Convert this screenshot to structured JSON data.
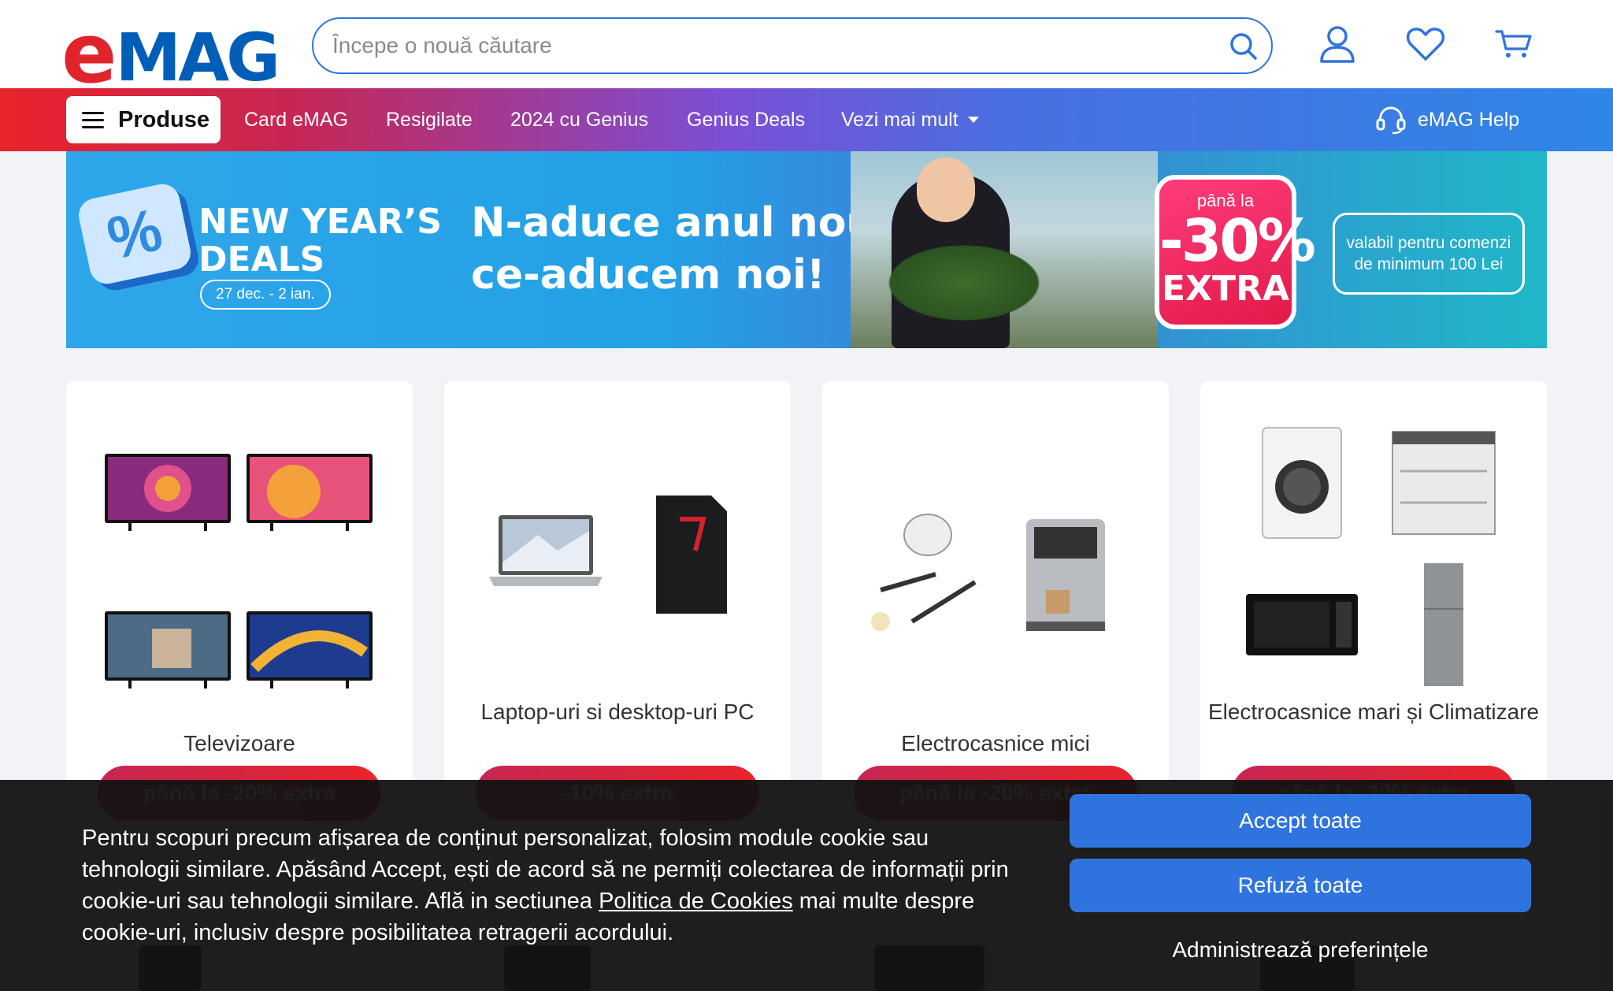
{
  "header": {
    "logo_text_e": "e",
    "logo_text_rest": "MAG",
    "search_placeholder": "Începe o nouă căutare",
    "search_icon": "search-icon",
    "account_icon": "user-icon",
    "favorites_icon": "heart-icon",
    "cart_icon": "cart-icon"
  },
  "nav": {
    "products_label": "Produse",
    "links": [
      "Card eMAG",
      "Resigilate",
      "2024 cu Genius",
      "Genius Deals",
      "Vezi mai mult"
    ],
    "help_label": "eMAG Help"
  },
  "banner": {
    "deals_title_line1": "NEW YEAR’S",
    "deals_title_line2": "DEALS",
    "dates": "27 dec. - 2 ian.",
    "headline_line1": "N-aduce anul nou,",
    "headline_line2": "ce-aducem noi!",
    "badge_top": "până la",
    "badge_value": "-30%",
    "badge_extra": "EXTRA",
    "valid_note": "valabil pentru comenzi de minimum 100 Lei"
  },
  "cards": [
    {
      "title": "Televizoare",
      "cta": "până la -20% extra"
    },
    {
      "title": "Laptop-uri si desktop-uri PC",
      "cta": "-10% extra"
    },
    {
      "title": "Electrocasnice mici",
      "cta": "până la -20% extra"
    },
    {
      "title": "Electrocasnice mari și Climatizare",
      "cta": "până la -20% extra"
    }
  ],
  "cookie": {
    "text_before_link": "Pentru scopuri precum afișarea de conținut personalizat, folosim module cookie sau tehnologii similare. Apăsând Accept, ești de acord să ne permiți colectarea de informații prin cookie-uri sau tehnologii similare. Află in sectiunea ",
    "link_text": "Politica de Cookies",
    "text_after_link": " mai multe despre cookie-uri, inclusiv despre posibilitatea retragerii acordului.",
    "accept_label": "Accept toate",
    "refuse_label": "Refuză toate",
    "manage_label": "Administrează preferințele"
  },
  "colors": {
    "brand_blue": "#005eb8",
    "brand_red": "#e0242c",
    "button_blue": "#2f74de"
  }
}
